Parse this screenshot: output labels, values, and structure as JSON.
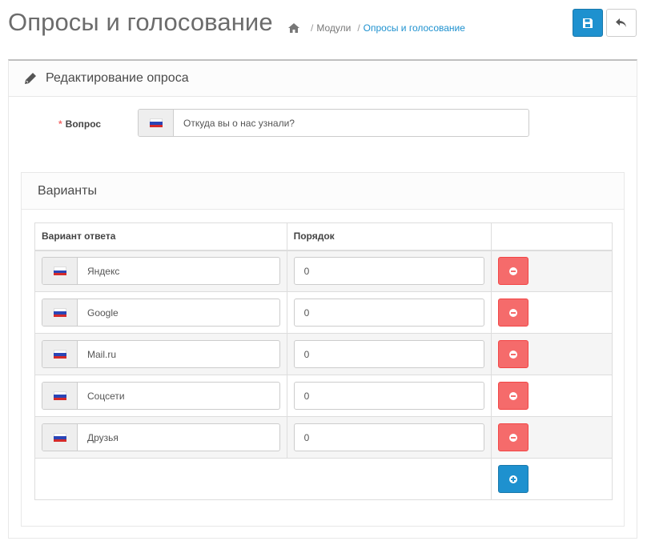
{
  "header": {
    "title": "Опросы и голосование",
    "breadcrumbs": [
      {
        "label": "Модули",
        "active": false
      },
      {
        "label": "Опросы и голосование",
        "active": true
      }
    ],
    "home_icon": "home-icon",
    "save_icon": "floppy-disk-icon",
    "back_icon": "reply-arrow-icon"
  },
  "panel": {
    "title": "Редактирование опроса",
    "title_icon": "pencil-icon",
    "question": {
      "required_mark": "*",
      "label": "Вопрос",
      "language_icon": "russian-flag-icon",
      "value": "Откуда вы о нас узнали?"
    }
  },
  "variants": {
    "title": "Варианты",
    "columns": [
      "Вариант ответа",
      "Порядок",
      ""
    ],
    "rows": [
      {
        "answer": "Яндекс",
        "order": "0"
      },
      {
        "answer": "Google",
        "order": "0"
      },
      {
        "answer": "Mail.ru",
        "order": "0"
      },
      {
        "answer": "Соцсети",
        "order": "0"
      },
      {
        "answer": "Друзья",
        "order": "0"
      }
    ],
    "remove_icon": "minus-circle-icon",
    "add_icon": "plus-circle-icon"
  },
  "colors": {
    "primary": "#1e91cf",
    "danger": "#f56b6b",
    "required": "#f56b6b",
    "title": "#6c6c6c"
  }
}
